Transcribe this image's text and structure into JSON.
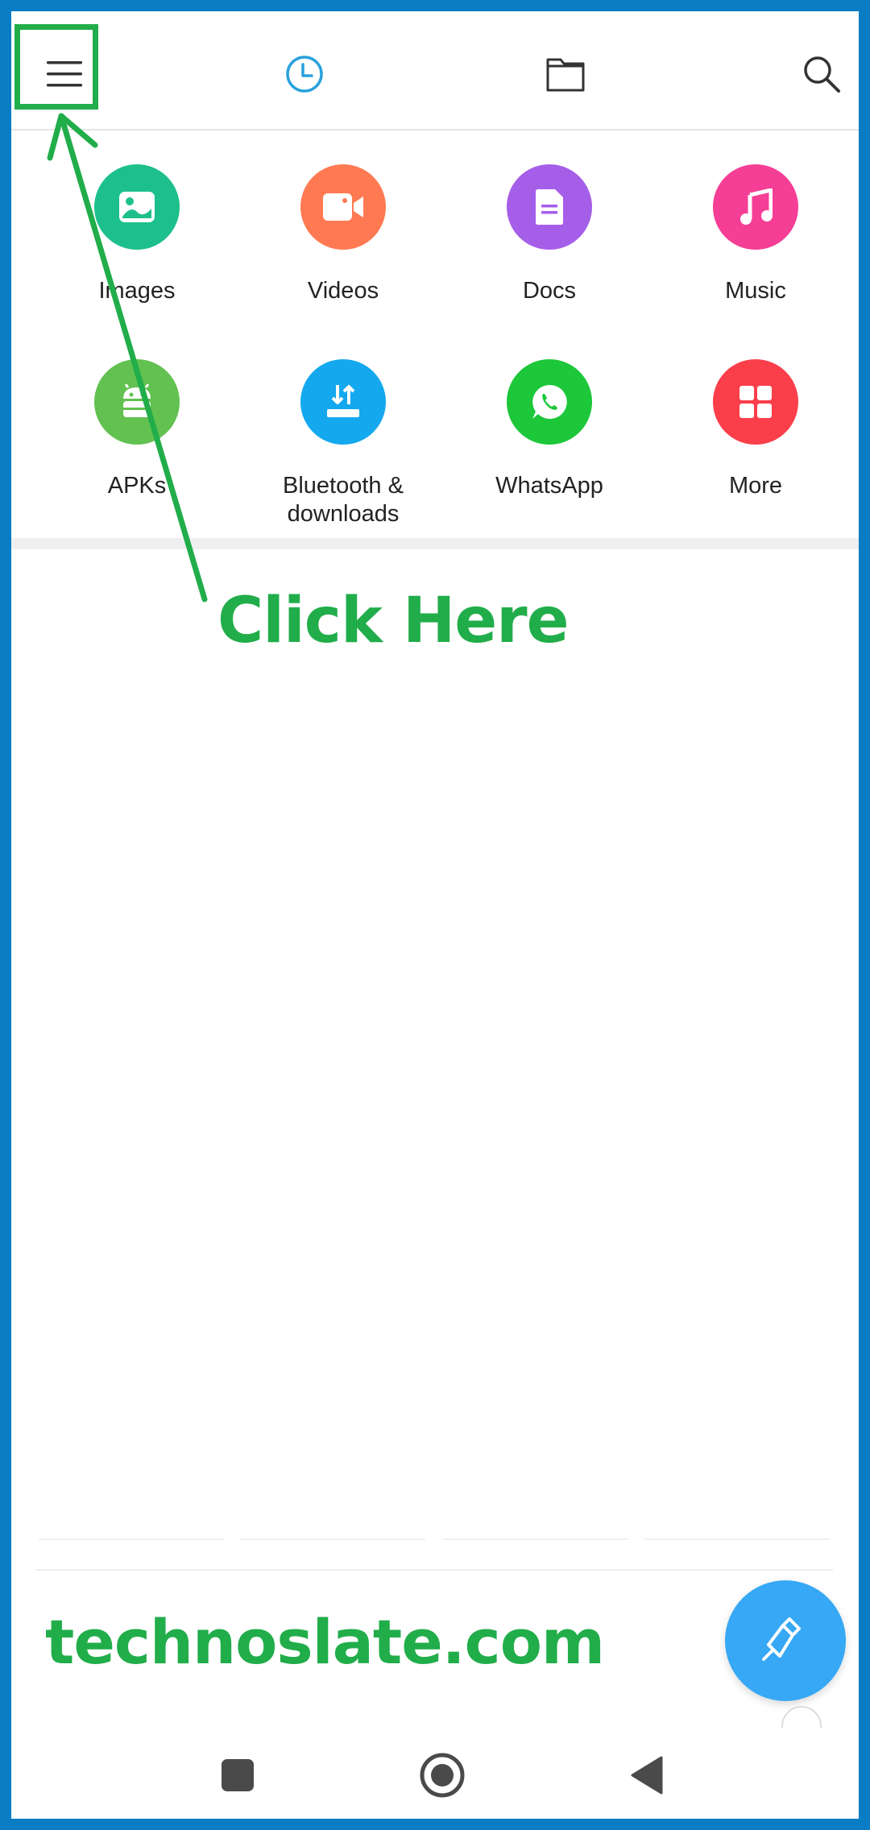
{
  "topbar": {
    "menu_icon": "hamburger-menu-icon",
    "recent_icon": "clock-icon",
    "files_icon": "folder-icon",
    "search_icon": "search-icon",
    "accent": "#2aa1dc"
  },
  "categories": [
    {
      "label": "Images",
      "icon": "image-icon",
      "color": "#1dc08c"
    },
    {
      "label": "Videos",
      "icon": "video-camera-icon",
      "color": "#ff7a52"
    },
    {
      "label": "Docs",
      "icon": "document-icon",
      "color": "#a55ee8"
    },
    {
      "label": "Music",
      "icon": "music-note-icon",
      "color": "#f53e96"
    },
    {
      "label": "APKs",
      "icon": "android-icon",
      "color": "#62c150"
    },
    {
      "label": "Bluetooth &\ndownloads",
      "icon": "download-icon",
      "color": "#14a8ee"
    },
    {
      "label": "WhatsApp",
      "icon": "whatsapp-icon",
      "color": "#1cc73a"
    },
    {
      "label": "More",
      "icon": "grid-icon",
      "color": "#fa3e4a"
    }
  ],
  "annotation": {
    "click_here": "Click Here",
    "site": "technoslate.com",
    "color": "#21ad4a"
  },
  "fab": {
    "icon": "broom-clean-icon",
    "color": "#36a8f5"
  },
  "navbar": {
    "recents_icon": "square-icon",
    "home_icon": "home-circle-icon",
    "back_icon": "back-triangle-icon"
  }
}
